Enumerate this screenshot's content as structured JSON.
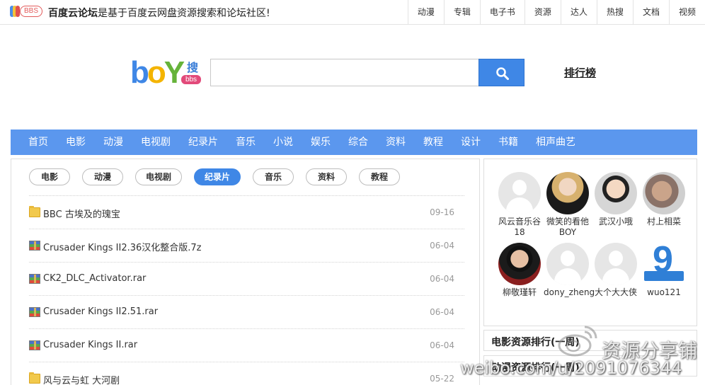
{
  "header": {
    "logo_text": "BBS",
    "slogan_bold": "百度云论坛",
    "slogan_rest": "是基于百度云网盘资源搜索和论坛社区!",
    "top_nav": [
      "动漫",
      "专辑",
      "电子书",
      "资源",
      "达人",
      "热搜",
      "文档",
      "视频"
    ]
  },
  "search": {
    "brand_text": "boY",
    "brand_sou": "搜",
    "brand_bbs": "bbs",
    "input_value": "",
    "ranking_label": "排行榜"
  },
  "main_nav": [
    "首页",
    "电影",
    "动漫",
    "电视剧",
    "纪录片",
    "音乐",
    "小说",
    "娱乐",
    "综合",
    "资料",
    "教程",
    "设计",
    "书籍",
    "相声曲艺"
  ],
  "content": {
    "pills": [
      {
        "label": "电影",
        "active": false
      },
      {
        "label": "动漫",
        "active": false
      },
      {
        "label": "电视剧",
        "active": false
      },
      {
        "label": "纪录片",
        "active": true
      },
      {
        "label": "音乐",
        "active": false
      },
      {
        "label": "资料",
        "active": false
      },
      {
        "label": "教程",
        "active": false
      }
    ],
    "files": [
      {
        "icon": "folder",
        "name": "BBC 古埃及的瑰宝",
        "date": "09-16"
      },
      {
        "icon": "archive",
        "name": "Crusader Kings II2.36汉化整合版.7z",
        "date": "06-04"
      },
      {
        "icon": "archive",
        "name": "CK2_DLC_Activator.rar",
        "date": "06-04"
      },
      {
        "icon": "archive",
        "name": "Crusader Kings II2.51.rar",
        "date": "06-04"
      },
      {
        "icon": "archive",
        "name": "Crusader Kings II.rar",
        "date": "06-04"
      },
      {
        "icon": "folder",
        "name": "风与云与虹 大河剧",
        "date": "05-22"
      }
    ]
  },
  "sidebar": {
    "users": [
      {
        "name": "风云音乐谷18",
        "avatar": "placeholder"
      },
      {
        "name": "微笑的看他BOY",
        "avatar": "photo-a"
      },
      {
        "name": "武汉小哦",
        "avatar": "photo-b"
      },
      {
        "name": "村上相菜",
        "avatar": "photo-c"
      },
      {
        "name": "柳敬瑾轩",
        "avatar": "photo-d"
      },
      {
        "name": "dony_zheng",
        "avatar": "placeholder"
      },
      {
        "name": "大个大大侠",
        "avatar": "placeholder"
      },
      {
        "name": "wuo121",
        "avatar": "logo"
      }
    ],
    "rank_movie": "电影资源排行(一周)",
    "rank_anime": "动漫资源排行(一周)"
  },
  "watermark": {
    "cn": "资源分享铺",
    "url": "weibo.com/u/2091076344"
  },
  "colors": {
    "nav_blue": "#5b97ee",
    "button_blue": "#3f87e6"
  }
}
